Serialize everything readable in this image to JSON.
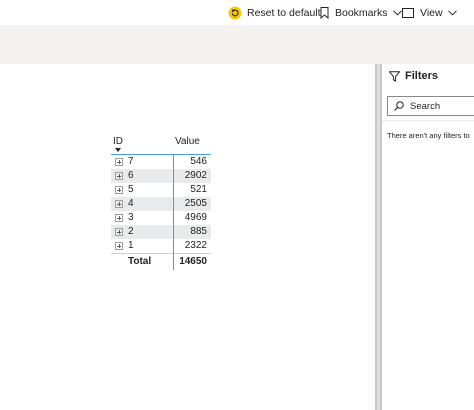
{
  "toolbar": {
    "reset_label": "Reset to default",
    "bookmarks_label": "Bookmarks",
    "view_label": "View"
  },
  "filters": {
    "title": "Filters",
    "search_placeholder": "Search",
    "empty_message": "There aren't any filters to"
  },
  "matrix": {
    "headers": {
      "id": "ID",
      "value": "Value"
    },
    "rows": [
      {
        "id": "7",
        "value": "546"
      },
      {
        "id": "6",
        "value": "2902"
      },
      {
        "id": "5",
        "value": "521"
      },
      {
        "id": "4",
        "value": "2505"
      },
      {
        "id": "3",
        "value": "4969"
      },
      {
        "id": "2",
        "value": "885"
      },
      {
        "id": "1",
        "value": "2322"
      }
    ],
    "total": {
      "label": "Total",
      "value": "14650"
    }
  },
  "colors": {
    "accent_yellow": "#f2c811",
    "column_accent": "#479ee3",
    "ribbon_bg": "#f3f2f1",
    "row_alt": "#e9eaeb",
    "divider": "#c8c6c4"
  }
}
